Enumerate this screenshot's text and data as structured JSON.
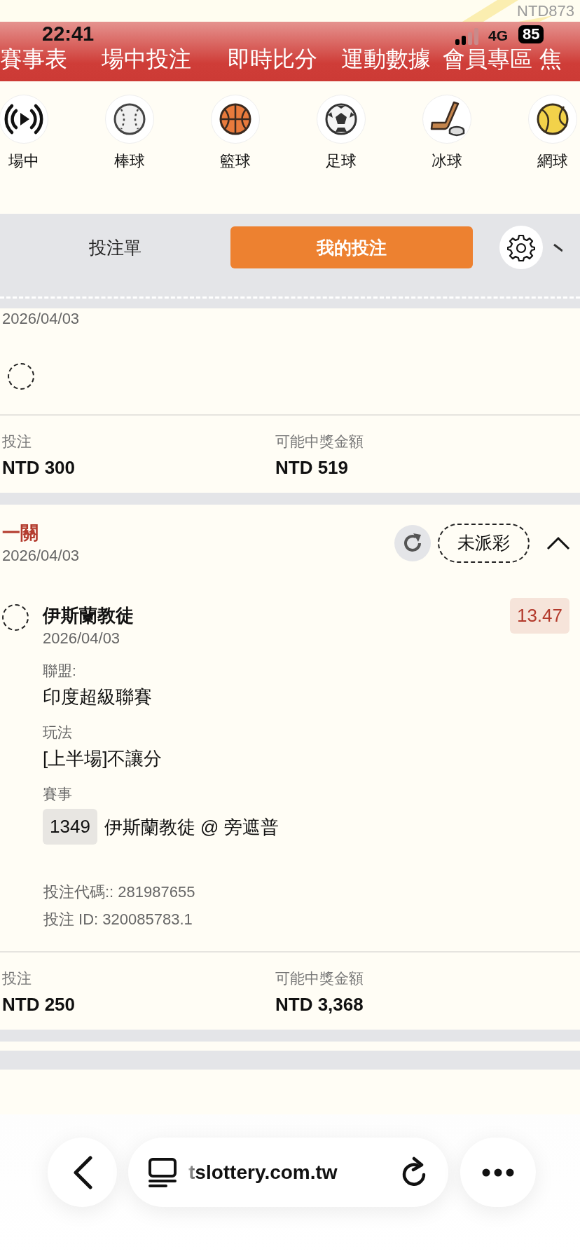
{
  "top_strip": {
    "balance": "NTD873"
  },
  "status_bar": {
    "time": "22:41",
    "network": "4G",
    "battery": "85"
  },
  "nav": [
    {
      "label": "賽事表"
    },
    {
      "label": "場中投注"
    },
    {
      "label": "即時比分"
    },
    {
      "label": "運動數據"
    },
    {
      "label": "會員專區"
    },
    {
      "label": "焦"
    }
  ],
  "sports": [
    {
      "label": "場中",
      "kind": "live"
    },
    {
      "label": "棒球",
      "kind": "baseball"
    },
    {
      "label": "籃球",
      "kind": "basketball"
    },
    {
      "label": "足球",
      "kind": "soccer"
    },
    {
      "label": "冰球",
      "kind": "hockey"
    },
    {
      "label": "網球",
      "kind": "tennis"
    }
  ],
  "bet_slip_tabs": [
    {
      "label": "投注單",
      "selected": false
    },
    {
      "label": "我的投注",
      "selected": true
    }
  ],
  "bets": [
    {
      "kind": "partial",
      "date": "2026/04/03",
      "stake_label": "投注",
      "stake": "NTD 300",
      "payout_label": "可能中獎金額",
      "payout": "NTD 519"
    },
    {
      "kind": "full",
      "type": "一關",
      "date": "2026/04/03",
      "status": "未派彩",
      "expanded": true,
      "legs": [
        {
          "team": "伊斯蘭教徒",
          "date": "2026/04/03",
          "odds": "13.47",
          "fields": [
            {
              "label": "聯盟:",
              "value": "印度超級聯賽"
            },
            {
              "label": "玩法",
              "value": "[上半場]不讓分"
            }
          ],
          "event_label": "賽事",
          "event_no": "1349",
          "event_name": "伊斯蘭教徒 @ 旁遮普"
        }
      ],
      "bet_code": "投注代碼:: 281987655",
      "bet_id": "投注 ID: 320085783.1",
      "stake_label": "投注",
      "stake": "NTD 250",
      "payout_label": "可能中獎金額",
      "payout": "NTD 3,368"
    }
  ],
  "browser": {
    "url": "tslottery.com.tw"
  }
}
